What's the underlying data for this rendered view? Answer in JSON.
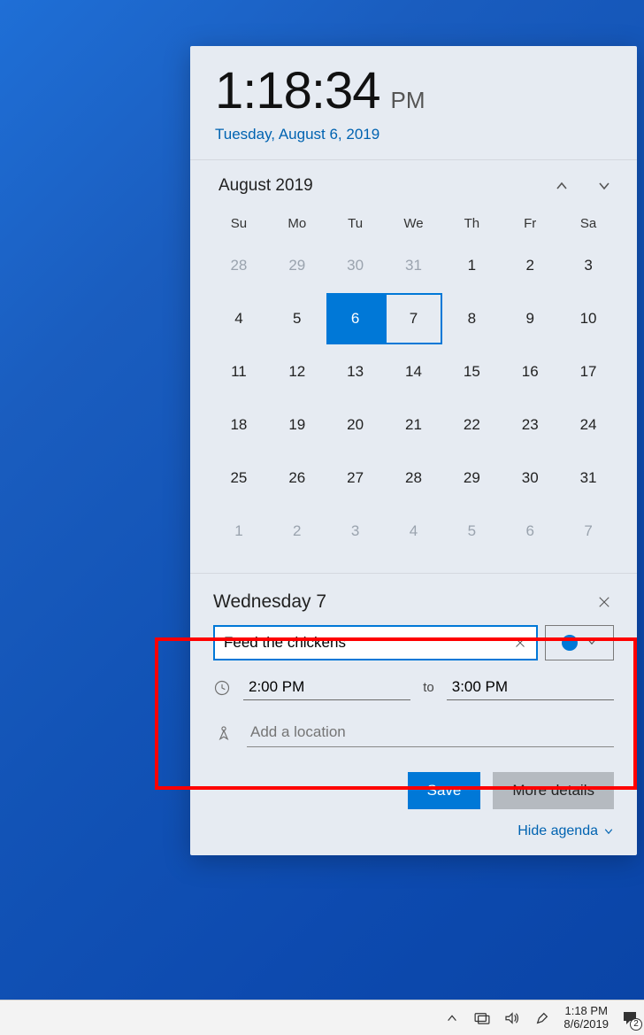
{
  "clock": {
    "time": "1:18:34",
    "ampm": "PM",
    "date_link": "Tuesday, August 6, 2019"
  },
  "calendar": {
    "title": "August 2019",
    "dows": [
      "Su",
      "Mo",
      "Tu",
      "We",
      "Th",
      "Fr",
      "Sa"
    ],
    "weeks": [
      [
        {
          "d": "28",
          "o": true
        },
        {
          "d": "29",
          "o": true
        },
        {
          "d": "30",
          "o": true
        },
        {
          "d": "31",
          "o": true
        },
        {
          "d": "1"
        },
        {
          "d": "2"
        },
        {
          "d": "3"
        }
      ],
      [
        {
          "d": "4"
        },
        {
          "d": "5"
        },
        {
          "d": "6",
          "today": true
        },
        {
          "d": "7",
          "sel": true
        },
        {
          "d": "8"
        },
        {
          "d": "9"
        },
        {
          "d": "10"
        }
      ],
      [
        {
          "d": "11"
        },
        {
          "d": "12"
        },
        {
          "d": "13"
        },
        {
          "d": "14"
        },
        {
          "d": "15"
        },
        {
          "d": "16"
        },
        {
          "d": "17"
        }
      ],
      [
        {
          "d": "18"
        },
        {
          "d": "19"
        },
        {
          "d": "20"
        },
        {
          "d": "21"
        },
        {
          "d": "22"
        },
        {
          "d": "23"
        },
        {
          "d": "24"
        }
      ],
      [
        {
          "d": "25"
        },
        {
          "d": "26"
        },
        {
          "d": "27"
        },
        {
          "d": "28"
        },
        {
          "d": "29"
        },
        {
          "d": "30"
        },
        {
          "d": "31"
        }
      ],
      [
        {
          "d": "1",
          "o": true
        },
        {
          "d": "2",
          "o": true
        },
        {
          "d": "3",
          "o": true
        },
        {
          "d": "4",
          "o": true
        },
        {
          "d": "5",
          "o": true
        },
        {
          "d": "6",
          "o": true
        },
        {
          "d": "7",
          "o": true
        }
      ]
    ]
  },
  "event": {
    "day_label": "Wednesday 7",
    "title_value": "Feed the chickens",
    "start": "2:00 PM",
    "to": "to",
    "end": "3:00 PM",
    "location_placeholder": "Add a location",
    "save": "Save",
    "more": "More details",
    "hide": "Hide agenda"
  },
  "tray": {
    "time": "1:18 PM",
    "date": "8/6/2019",
    "badge": "2"
  },
  "colors": {
    "accent": "#0078d7",
    "link": "#0063b1",
    "highlight": "#ff0000"
  }
}
